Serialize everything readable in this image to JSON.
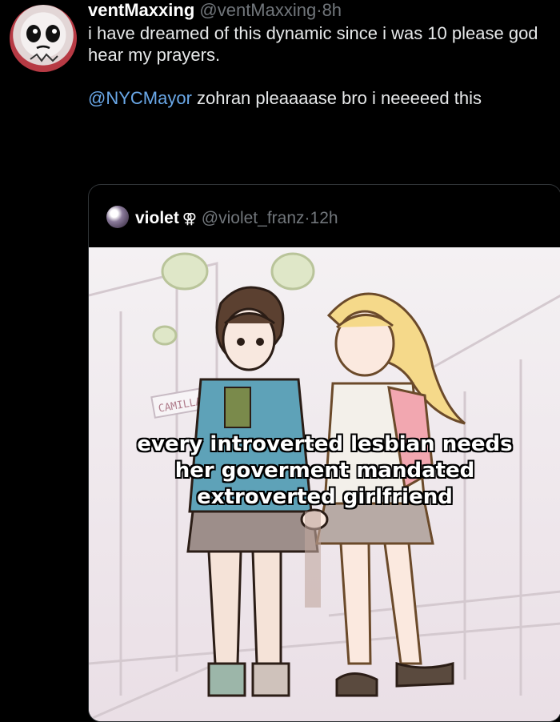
{
  "tweet": {
    "display_name": "ventMaxxing",
    "handle": "@ventMaxxing",
    "separator": "·",
    "time": "8h",
    "line1": "i have dreamed of this dynamic since i was 10 please god hear my prayers.",
    "mention": "@NYCMayor",
    "line2": " zohran pleaaaase bro i neeeeed this"
  },
  "quote": {
    "display_name": "violet",
    "symbol": "⚢",
    "handle": "@violet_franz",
    "separator": "·",
    "time": "12h",
    "caption_lines": [
      "every introverted lesbian needs",
      "her goverment mandated",
      "extroverted girlfriend"
    ],
    "sign_text": "CAMILLA"
  },
  "colors": {
    "background": "#000000",
    "text": "#e7e9ea",
    "muted": "#71767b",
    "mention": "#6aa8e8",
    "border": "#2f3336"
  },
  "icons": {
    "avatar": "avatar-icon",
    "quote_avatar": "quote-avatar-icon"
  }
}
